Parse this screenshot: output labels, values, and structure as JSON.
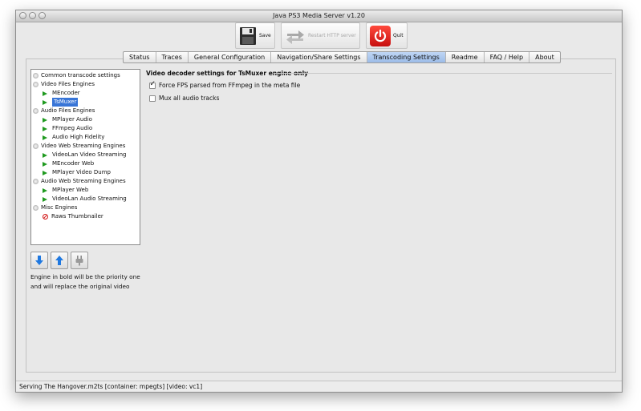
{
  "window": {
    "title": "Java PS3 Media Server v1.20"
  },
  "toolbar": {
    "save_label": "Save",
    "restart_label": "Restart HTTP server",
    "quit_label": "Quit"
  },
  "tabs": [
    "Status",
    "Traces",
    "General Configuration",
    "Navigation/Share Settings",
    "Transcoding Settings",
    "Readme",
    "FAQ / Help",
    "About"
  ],
  "active_tab": "Transcoding Settings",
  "tree": {
    "items": [
      {
        "label": "Common transcode settings",
        "level": 0,
        "icon": "bullet-icon"
      },
      {
        "label": "Video Files Engines",
        "level": 0,
        "icon": "bullet-icon"
      },
      {
        "label": "MEncoder",
        "level": 1,
        "icon": "play-icon"
      },
      {
        "label": "TsMuxer",
        "level": 1,
        "icon": "play-icon",
        "selected": true
      },
      {
        "label": "Audio Files Engines",
        "level": 0,
        "icon": "bullet-icon"
      },
      {
        "label": "MPlayer Audio",
        "level": 1,
        "icon": "play-icon"
      },
      {
        "label": "FFmpeg Audio",
        "level": 1,
        "icon": "play-icon"
      },
      {
        "label": "Audio High Fidelity",
        "level": 1,
        "icon": "play-icon"
      },
      {
        "label": "Video Web Streaming Engines",
        "level": 0,
        "icon": "bullet-icon"
      },
      {
        "label": "VideoLan Video Streaming",
        "level": 1,
        "icon": "play-icon"
      },
      {
        "label": "MEncoder Web",
        "level": 1,
        "icon": "play-icon"
      },
      {
        "label": "MPlayer Video Dump",
        "level": 1,
        "icon": "play-icon"
      },
      {
        "label": "Audio Web Streaming Engines",
        "level": 0,
        "icon": "bullet-icon"
      },
      {
        "label": "MPlayer Web",
        "level": 1,
        "icon": "play-icon"
      },
      {
        "label": "VideoLan Audio Streaming",
        "level": 1,
        "icon": "play-icon"
      },
      {
        "label": "Misc Engines",
        "level": 0,
        "icon": "bullet-icon"
      },
      {
        "label": "Raws Thumbnailer",
        "level": 1,
        "icon": "disabled-icon"
      }
    ]
  },
  "hint": {
    "line1": "Engine in bold will be the priority one",
    "line2": "and will replace the original video"
  },
  "settings": {
    "title": "Video decoder settings for TsMuxer engine only",
    "force_fps_label": "Force FPS parsed from FFmpeg in the meta file",
    "force_fps_checked": true,
    "mux_audio_label": "Mux all audio tracks",
    "mux_audio_checked": false
  },
  "status": "Serving The Hangover.m2ts [container: mpegts] [video: vc1]",
  "colors": {
    "selection": "#3875d7",
    "arrow_blue": "#1f78e0",
    "quit_red": "#e3231b",
    "play_green": "#1f9a1f"
  }
}
